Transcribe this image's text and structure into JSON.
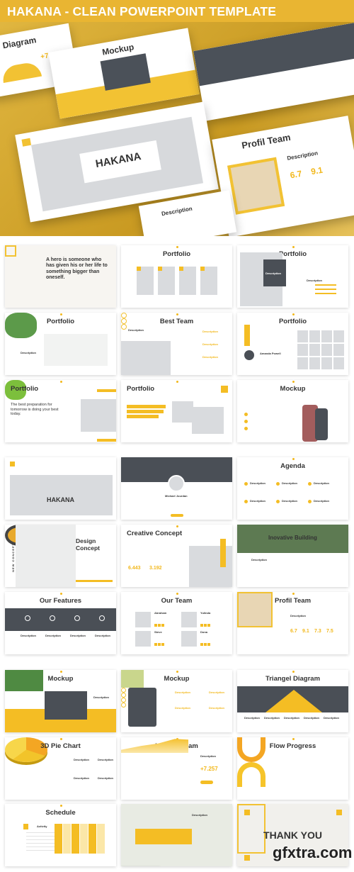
{
  "header": {
    "title": "HAKANA - CLEAN POWERPOINT TEMPLATE"
  },
  "colors": {
    "accent": "#e9b532",
    "slide_accent": "#f4bd24",
    "dark": "#4a4f56"
  },
  "hero": {
    "cards": [
      {
        "title": "Diagram",
        "value": "+7.257"
      },
      {
        "title": "Mockup"
      },
      {
        "title": "HAKANA"
      },
      {
        "title": "Profil Team",
        "description": "Description",
        "values": [
          "6.7",
          "9.1"
        ]
      },
      {
        "title": "Description"
      }
    ]
  },
  "slides": [
    {
      "kind": "quote",
      "title": "",
      "quote": "A hero is someone who has given his or her life to something bigger than oneself."
    },
    {
      "kind": "gallery",
      "title": "Portfolio"
    },
    {
      "kind": "terrarium",
      "title": "Portfolio",
      "label": "Description",
      "label2": "Description"
    },
    {
      "kind": "plant",
      "title": "Portfolio",
      "label": "Description"
    },
    {
      "kind": "team3",
      "title": "Best Team",
      "label": "Description",
      "items": [
        "Description",
        "Description",
        "Description"
      ]
    },
    {
      "kind": "grid",
      "title": "Portfolio",
      "label": "Amanda Powell"
    },
    {
      "kind": "quote2",
      "title": "Portfolio",
      "quote": "The best preparation for tomorrow is doing your best today."
    },
    {
      "kind": "bars",
      "title": "Portfolio"
    },
    {
      "kind": "phone",
      "title": "Mockup"
    },
    {
      "kind": "cover",
      "title": "HAKANA"
    },
    {
      "kind": "profile",
      "title": "",
      "label": "Michael Jourdan"
    },
    {
      "kind": "agenda",
      "title": "Agenda",
      "items": [
        "Description",
        "Description",
        "Description",
        "Description",
        "Description",
        "Description"
      ]
    },
    {
      "kind": "design",
      "title": "Design Concept",
      "side": "NEW CONCEPT"
    },
    {
      "kind": "creative",
      "title": "Creative Concept",
      "values": [
        "6.443",
        "3.192"
      ]
    },
    {
      "kind": "building",
      "title": "Inovative Building",
      "label": "Description"
    },
    {
      "kind": "features",
      "title": "Our Features",
      "items": [
        "Description",
        "Description",
        "Description",
        "Description"
      ]
    },
    {
      "kind": "ourteam",
      "title": "Our Team",
      "items": [
        "Abraham",
        "Yulinda",
        "Steve",
        "Dona"
      ]
    },
    {
      "kind": "profil",
      "title": "Profil Team",
      "label": "Description",
      "values": [
        "6.7",
        "9.1",
        "7.3",
        "7.5"
      ]
    },
    {
      "kind": "laptop",
      "title": "Mockup",
      "label": "Description"
    },
    {
      "kind": "tablet",
      "title": "Mockup",
      "items": [
        "Description",
        "Description",
        "Description",
        "Description"
      ]
    },
    {
      "kind": "triangle",
      "title": "Triangel Diagram",
      "items": [
        "Description",
        "Description",
        "Description",
        "Description",
        "Description"
      ]
    },
    {
      "kind": "pie",
      "title": "3D Pie Chart",
      "items": [
        "Description",
        "Description",
        "Description",
        "Description"
      ]
    },
    {
      "kind": "hills",
      "title": "Hills Diagram",
      "label": "Description",
      "value": "+7.257"
    },
    {
      "kind": "flow",
      "title": "Flow Progress"
    },
    {
      "kind": "schedule",
      "title": "Schedule",
      "label": "Activity"
    },
    {
      "kind": "map",
      "title": "",
      "label": "Description"
    },
    {
      "kind": "thanks",
      "title": "THANK YOU"
    }
  ],
  "watermark": "gfxtra.com"
}
